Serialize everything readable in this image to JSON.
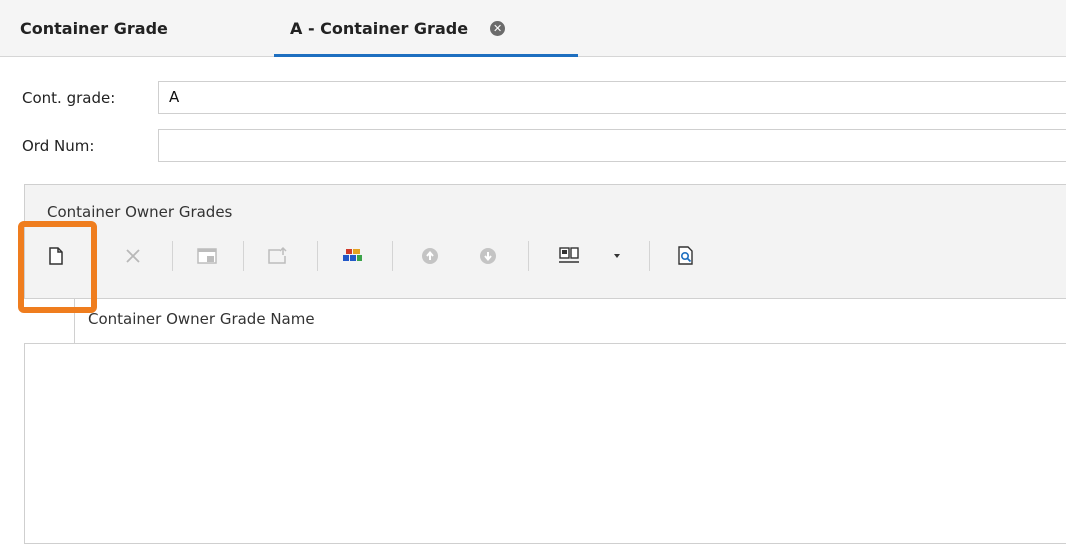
{
  "tabs": [
    {
      "label": "Container Grade"
    },
    {
      "label": "A - Container Grade",
      "active": true
    }
  ],
  "form": {
    "cont_grade_label": "Cont. grade:",
    "cont_grade_value": "A",
    "ord_num_label": "Ord Num:",
    "ord_num_value": ""
  },
  "group": {
    "title": "Container Owner Grades",
    "toolbar": [
      {
        "icon": "new-document-icon",
        "enabled": true
      },
      {
        "icon": "delete-x-icon",
        "enabled": false
      },
      {
        "icon": "window-icon",
        "enabled": false
      },
      {
        "icon": "export-icon",
        "enabled": false
      },
      {
        "icon": "colored-blocks-icon",
        "enabled": true
      },
      {
        "icon": "move-up-icon",
        "enabled": false
      },
      {
        "icon": "move-down-icon",
        "enabled": false
      },
      {
        "icon": "column-chooser-icon",
        "enabled": true
      },
      {
        "icon": "dropdown-arrow-icon",
        "enabled": true
      },
      {
        "icon": "print-preview-icon",
        "enabled": true
      }
    ],
    "grid": {
      "columns": [
        "Container Owner Grade Name"
      ],
      "rows": []
    }
  },
  "colors": {
    "highlight": "#ef7d1e",
    "active_tab_underline": "#1e6fc0"
  }
}
